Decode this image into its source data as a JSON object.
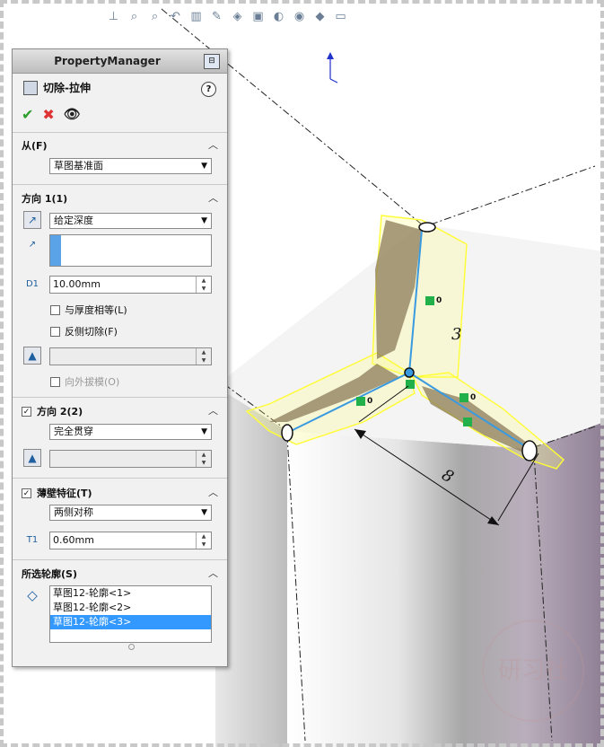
{
  "property_manager": {
    "title": "PropertyManager",
    "feature_name": "切除-拉伸",
    "help_icon": "?",
    "sections": {
      "from": {
        "label": "从(F)",
        "value": "草图基准面"
      },
      "direction1": {
        "label": "方向 1(1)",
        "end_condition": "给定深度",
        "depth": "10.00mm",
        "equal_thickness": "与厚度相等(L)",
        "flip_side": "反侧切除(F)",
        "draft_outward": "向外拔模(O)"
      },
      "direction2": {
        "label": "方向 2(2)",
        "checked": true,
        "end_condition": "完全贯穿"
      },
      "thin_feature": {
        "label": "薄壁特征(T)",
        "checked": true,
        "type": "两侧对称",
        "thickness": "0.60mm"
      },
      "selected_contours": {
        "label": "所选轮廓(S)",
        "items": [
          "草图12-轮廓<1>",
          "草图12-轮廓<2>",
          "草图12-轮廓<3>"
        ],
        "selected_index": 2
      }
    }
  },
  "viewport": {
    "dimension_vertical": "3",
    "dimension_diagonal": "8",
    "relation_label": "0"
  },
  "colors": {
    "preview_yellow": "#ffff33",
    "sketch_blue": "#3a9ae0",
    "selection_blue": "#3399ff",
    "relation_green": "#22b04a"
  },
  "toolbar_icons": [
    "view-orientation-icon",
    "zoom-to-fit-icon",
    "zoom-area-icon",
    "previous-view-icon",
    "section-view-icon",
    "dynamic-annotation-icon",
    "view-cube-icon",
    "display-style-icon",
    "hide-show-icon",
    "edit-appearance-icon",
    "apply-scene-icon",
    "view-settings-icon"
  ]
}
